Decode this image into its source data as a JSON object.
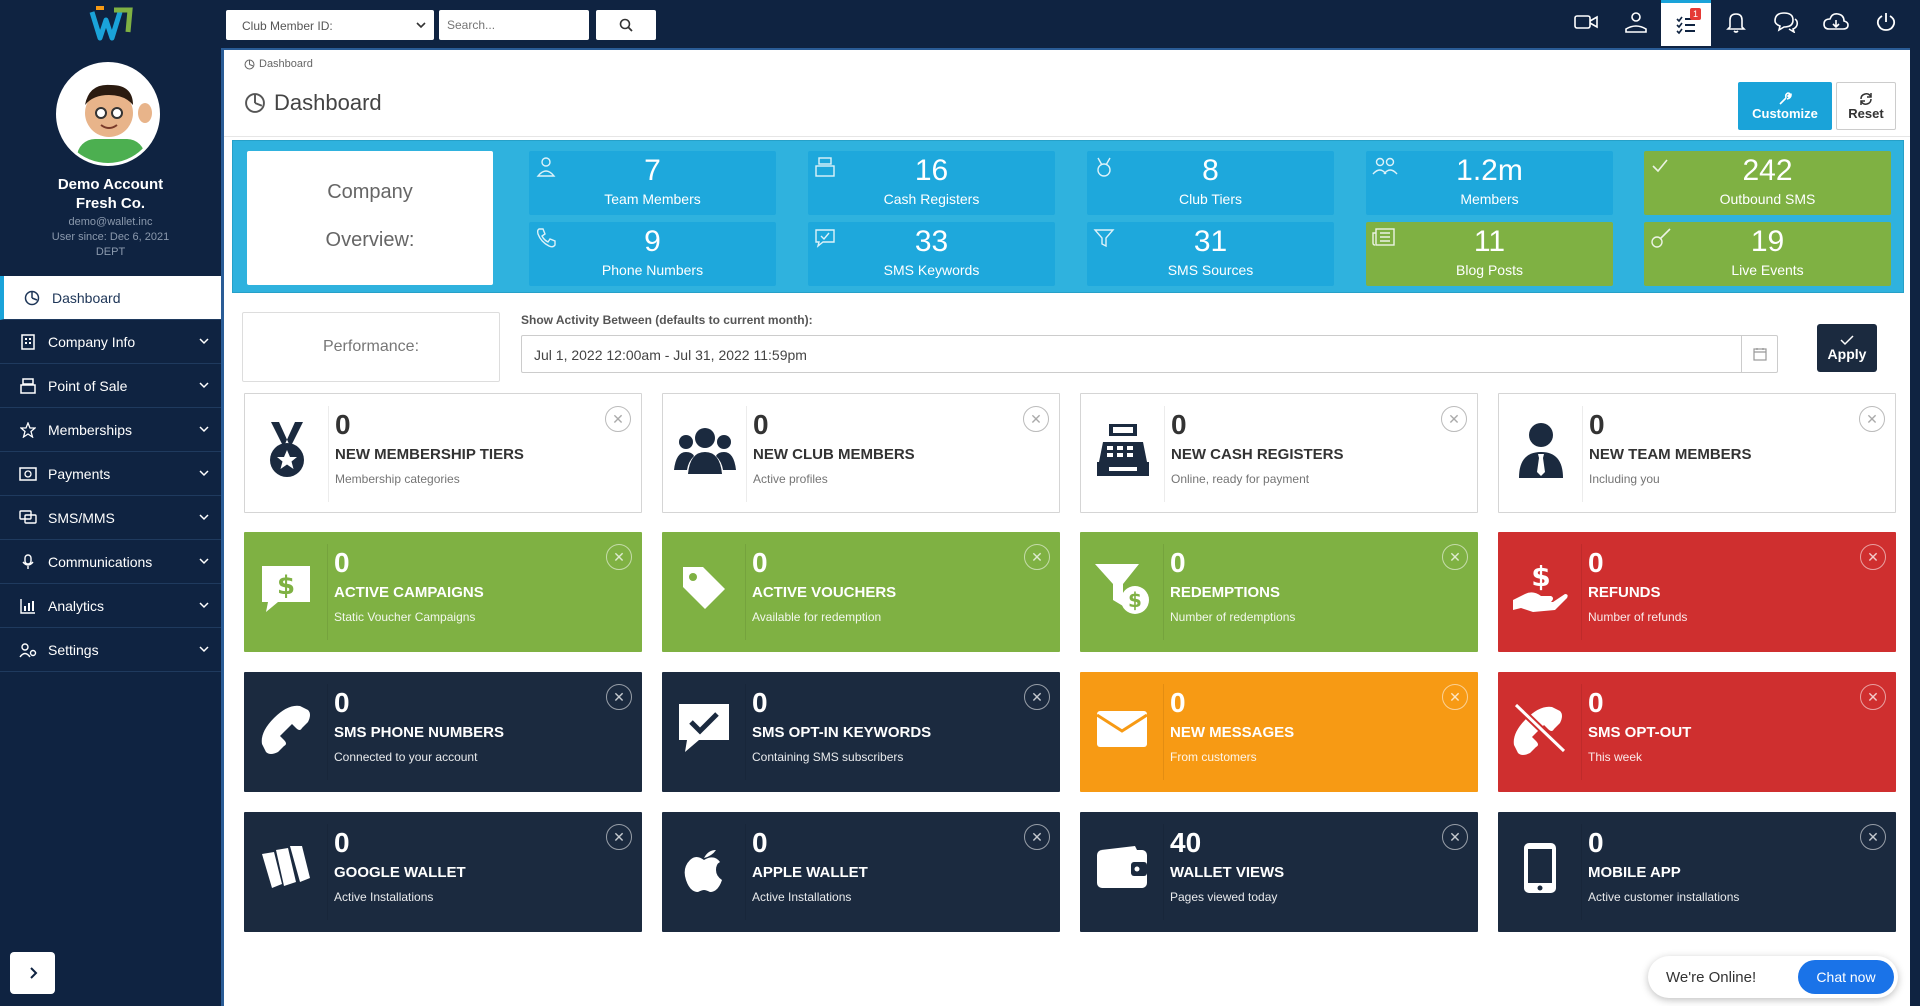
{
  "account": {
    "name_line1": "Demo Account",
    "name_line2": "Fresh Co.",
    "email": "demo@wallet.inc",
    "since": "User since: Dec 6, 2021",
    "dept": "DEPT"
  },
  "sidebar": {
    "items": [
      {
        "label": "Dashboard"
      },
      {
        "label": "Company Info"
      },
      {
        "label": "Point of Sale"
      },
      {
        "label": "Memberships"
      },
      {
        "label": "Payments"
      },
      {
        "label": "SMS/MMS"
      },
      {
        "label": "Communications"
      },
      {
        "label": "Analytics"
      },
      {
        "label": "Settings"
      }
    ]
  },
  "topbar": {
    "select_value": "Club Member ID:",
    "search_placeholder": "Search...",
    "notification_badge": "1"
  },
  "page": {
    "breadcrumb": "Dashboard",
    "title": "Dashboard",
    "customize_label": "Customize",
    "reset_label": "Reset"
  },
  "overview": {
    "label_line1": "Company",
    "label_line2": "Overview:",
    "tiles": [
      {
        "value": "7",
        "label": "Team Members",
        "color": "#1ea8dc"
      },
      {
        "value": "16",
        "label": "Cash Registers",
        "color": "#1ea8dc"
      },
      {
        "value": "8",
        "label": "Club Tiers",
        "color": "#1ea8dc"
      },
      {
        "value": "1.2m",
        "label": "Members",
        "color": "#1ea8dc"
      },
      {
        "value": "242",
        "label": "Outbound SMS",
        "color": "#7fb143"
      },
      {
        "value": "9",
        "label": "Phone Numbers",
        "color": "#1ea8dc"
      },
      {
        "value": "33",
        "label": "SMS Keywords",
        "color": "#1ea8dc"
      },
      {
        "value": "31",
        "label": "SMS Sources",
        "color": "#1ea8dc"
      },
      {
        "value": "11",
        "label": "Blog Posts",
        "color": "#7fb143"
      },
      {
        "value": "19",
        "label": "Live Events",
        "color": "#7fb143"
      }
    ]
  },
  "performance": {
    "label": "Performance:",
    "activity_label": "Show Activity Between (defaults to current month):",
    "date_range": "Jul 1, 2022 12:00am - Jul 31, 2022 11:59pm",
    "apply_label": "Apply"
  },
  "cards": [
    {
      "value": "0",
      "title": "NEW MEMBERSHIP TIERS",
      "sub": "Membership categories",
      "style": "white",
      "icon": "medal-icon"
    },
    {
      "value": "0",
      "title": "NEW CLUB MEMBERS",
      "sub": "Active profiles",
      "style": "white",
      "icon": "users-icon"
    },
    {
      "value": "0",
      "title": "NEW CASH REGISTERS",
      "sub": "Online, ready for payment",
      "style": "white",
      "icon": "cash-register-icon"
    },
    {
      "value": "0",
      "title": "NEW TEAM MEMBERS",
      "sub": "Including you",
      "style": "white",
      "icon": "user-tie-icon"
    },
    {
      "value": "0",
      "title": "ACTIVE CAMPAIGNS",
      "sub": "Static Voucher Campaigns",
      "style": "green",
      "icon": "money-bill-icon"
    },
    {
      "value": "0",
      "title": "ACTIVE VOUCHERS",
      "sub": "Available for redemption",
      "style": "green",
      "icon": "tag-icon"
    },
    {
      "value": "0",
      "title": "REDEMPTIONS",
      "sub": "Number of redemptions",
      "style": "green",
      "icon": "filter-dollar-icon"
    },
    {
      "value": "0",
      "title": "REFUNDS",
      "sub": "Number of refunds",
      "style": "red",
      "icon": "hand-dollar-icon"
    },
    {
      "value": "0",
      "title": "SMS PHONE NUMBERS",
      "sub": "Connected to your account",
      "style": "dark",
      "icon": "phone-icon"
    },
    {
      "value": "0",
      "title": "SMS OPT-IN KEYWORDS",
      "sub": "Containing SMS subscribers",
      "style": "dark",
      "icon": "comment-check-icon"
    },
    {
      "value": "0",
      "title": "NEW MESSAGES",
      "sub": "From customers",
      "style": "orange",
      "icon": "envelope-icon"
    },
    {
      "value": "0",
      "title": "SMS OPT-OUT",
      "sub": "This week",
      "style": "red",
      "icon": "phone-slash-icon"
    },
    {
      "value": "0",
      "title": "GOOGLE WALLET",
      "sub": "Active Installations",
      "style": "dark",
      "icon": "google-wallet-icon"
    },
    {
      "value": "0",
      "title": "APPLE WALLET",
      "sub": "Active Installations",
      "style": "dark",
      "icon": "apple-icon"
    },
    {
      "value": "40",
      "title": "WALLET VIEWS",
      "sub": "Pages viewed today",
      "style": "dark",
      "icon": "wallet-icon"
    },
    {
      "value": "0",
      "title": "MOBILE APP",
      "sub": "Active customer installations",
      "style": "dark",
      "icon": "mobile-icon"
    }
  ],
  "chat": {
    "status": "We're Online!",
    "button": "Chat now"
  }
}
